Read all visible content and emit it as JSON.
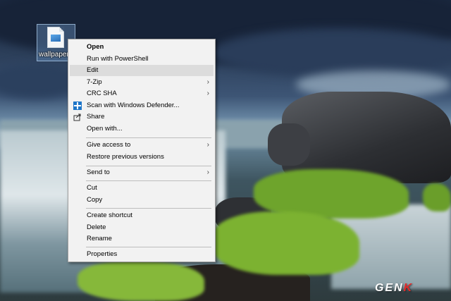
{
  "desktop": {
    "icon_label": "wallpaper-"
  },
  "context_menu": {
    "items": [
      {
        "label": "Open",
        "bold": true
      },
      {
        "label": "Run with PowerShell"
      },
      {
        "label": "Edit",
        "highlighted": true
      },
      {
        "label": "7-Zip",
        "submenu": true
      },
      {
        "label": "CRC SHA",
        "submenu": true
      },
      {
        "label": "Scan with Windows Defender...",
        "icon": "windows-defender-icon"
      },
      {
        "label": "Share",
        "icon": "share-icon"
      },
      {
        "label": "Open with..."
      },
      {
        "label": "Give access to",
        "submenu": true
      },
      {
        "label": "Restore previous versions"
      },
      {
        "label": "Send to",
        "submenu": true
      },
      {
        "label": "Cut"
      },
      {
        "label": "Copy"
      },
      {
        "label": "Create shortcut"
      },
      {
        "label": "Delete"
      },
      {
        "label": "Rename"
      },
      {
        "label": "Properties"
      }
    ],
    "submenu_glyph": "›"
  },
  "watermark": {
    "text_main": "GEN",
    "text_accent": "K"
  }
}
